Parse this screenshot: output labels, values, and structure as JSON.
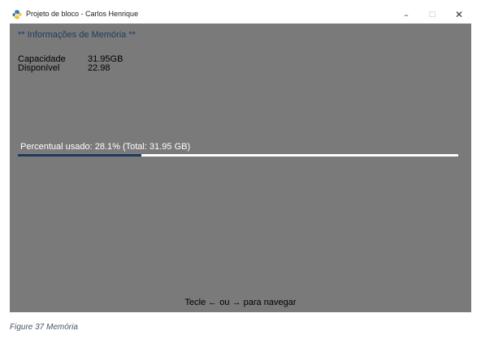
{
  "window": {
    "title": "Projeto de bloco - Carlos Henrique",
    "app_icon": "python-icon",
    "controls": {
      "minimize": "–",
      "maximize": "□",
      "close": "✕"
    }
  },
  "memory": {
    "heading": "** Informações de Memória **",
    "capacity_label": "Capacidade",
    "capacity_value": "31.95GB",
    "available_label": "Disponível",
    "available_value": "22.98",
    "usage_text": "Percentual usado: 28.1% (Total: 31.95 GB)",
    "usage_fraction": 0.281
  },
  "footer": {
    "nav_hint": "Tecle ← ou → para navegar"
  },
  "caption": "Figure 37 Memória",
  "colors": {
    "background": "#7a7a7a",
    "accent": "#1e3a5f",
    "track": "#ffffff"
  }
}
